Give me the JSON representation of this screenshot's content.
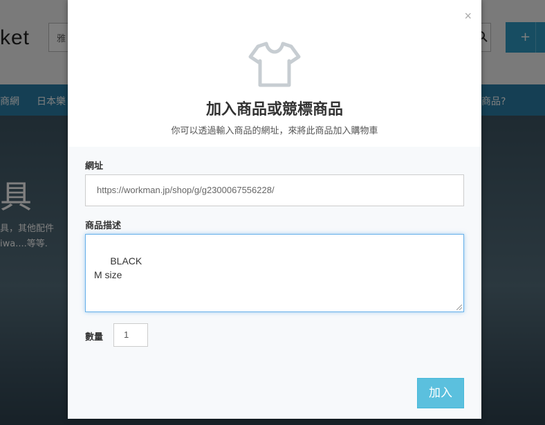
{
  "background": {
    "logo": "ket",
    "search_hint": "雅",
    "plus_label": "+",
    "nav_items": [
      "商網",
      "日本樂",
      "商品?"
    ],
    "hero_big": "具",
    "hero_line1": "具，其他配件",
    "hero_line2": "iwa....等等."
  },
  "modal": {
    "close_label": "×",
    "icon": "tshirt-icon",
    "title": "加入商品或競標商品",
    "subtitle": "你可以透過輸入商品的網址，來將此商品加入購物車",
    "url_label": "網址",
    "url_value": "https://workman.jp/shop/g/g2300067556228/",
    "desc_label": "商品描述",
    "desc_value": "BLACK\nM size",
    "qty_label": "數量",
    "qty_value": "1",
    "add_button": "加入"
  }
}
